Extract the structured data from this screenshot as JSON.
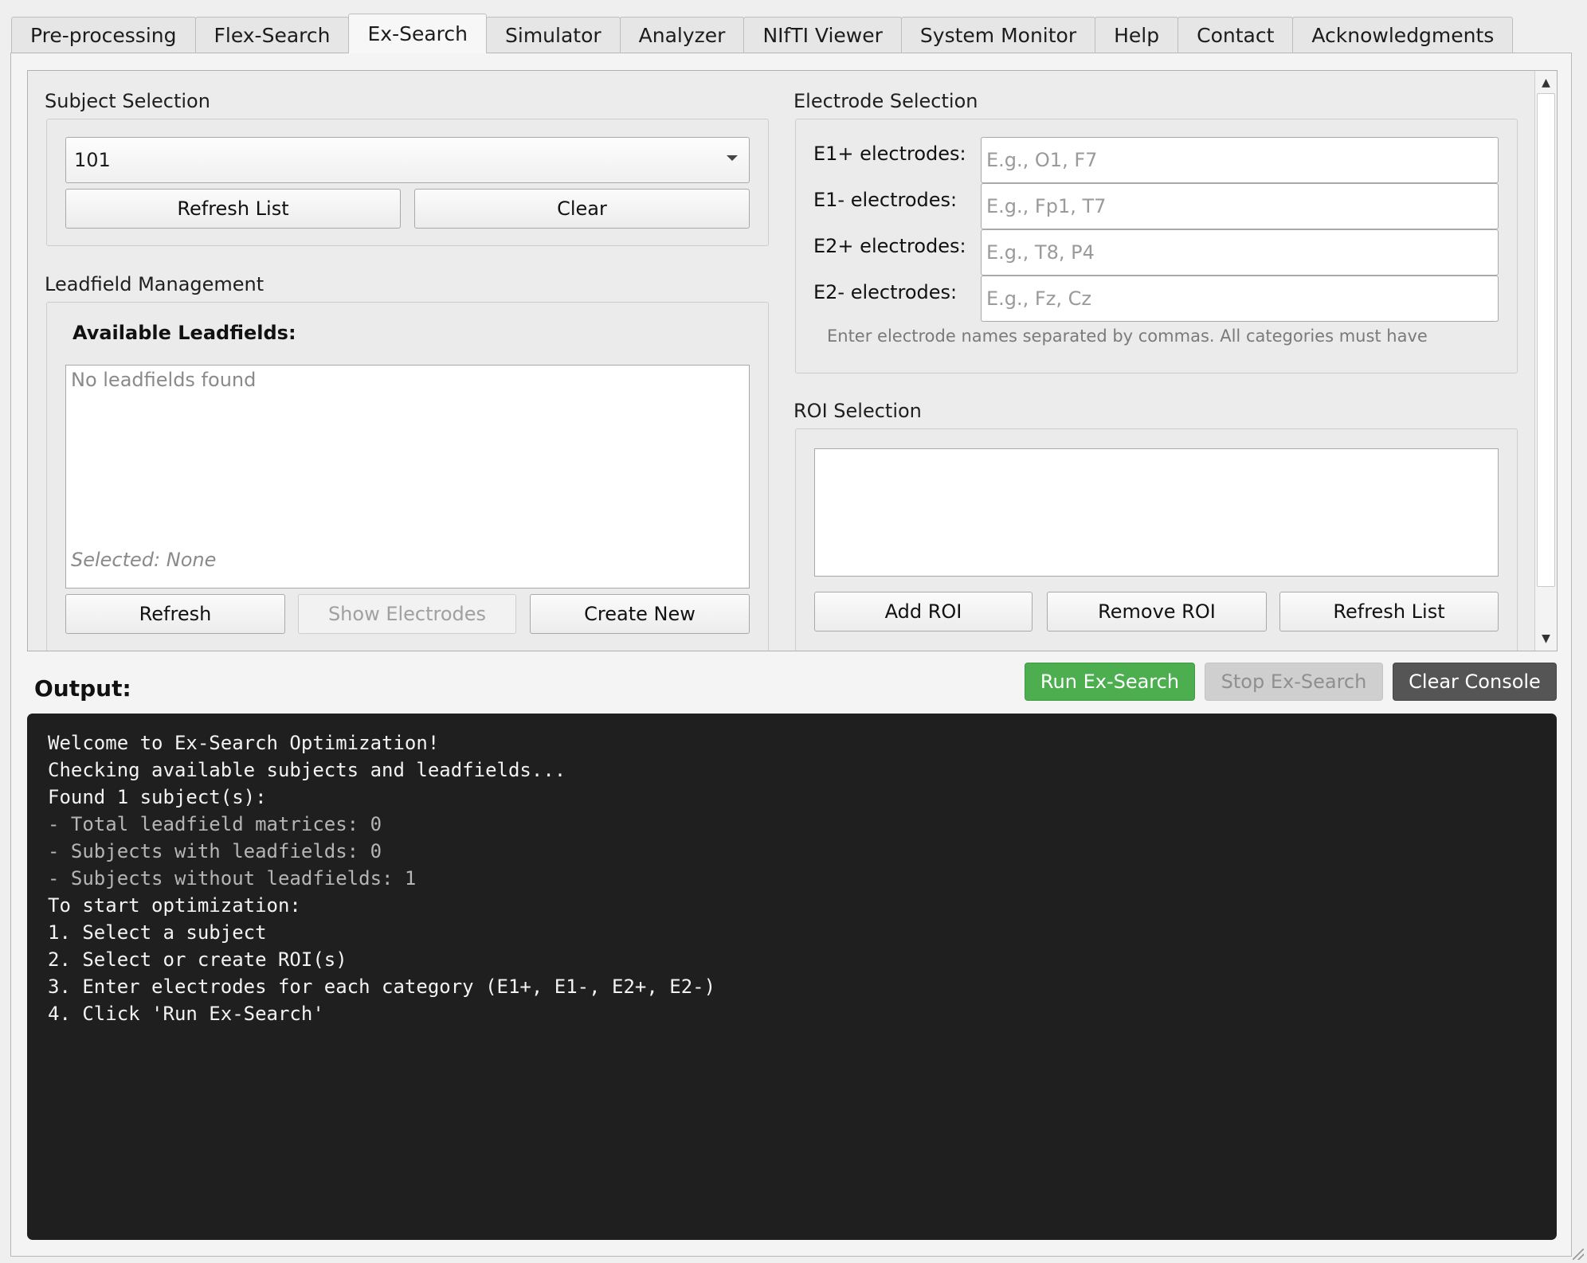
{
  "tabs": [
    {
      "label": "Pre-processing",
      "active": false
    },
    {
      "label": "Flex-Search",
      "active": false
    },
    {
      "label": "Ex-Search",
      "active": true
    },
    {
      "label": "Simulator",
      "active": false
    },
    {
      "label": "Analyzer",
      "active": false
    },
    {
      "label": "NIfTI Viewer",
      "active": false
    },
    {
      "label": "System Monitor",
      "active": false
    },
    {
      "label": "Help",
      "active": false
    },
    {
      "label": "Contact",
      "active": false
    },
    {
      "label": "Acknowledgments",
      "active": false
    }
  ],
  "subject_selection": {
    "title": "Subject Selection",
    "selected": "101",
    "refresh_label": "Refresh List",
    "clear_label": "Clear"
  },
  "leadfield": {
    "title": "Leadfield Management",
    "heading": "Available Leadfields:",
    "empty_text": "No leadfields found",
    "selected_text": "Selected: None",
    "refresh_label": "Refresh",
    "show_electrodes_label": "Show Electrodes",
    "create_new_label": "Create New"
  },
  "electrodes": {
    "title": "Electrode Selection",
    "e1_plus": {
      "label": "E1+ electrodes:",
      "placeholder": "E.g., O1, F7",
      "value": ""
    },
    "e1_minus": {
      "label": "E1- electrodes:",
      "placeholder": "E.g., Fp1, T7",
      "value": ""
    },
    "e2_plus": {
      "label": "E2+ electrodes:",
      "placeholder": "E.g., T8, P4",
      "value": ""
    },
    "e2_minus": {
      "label": "E2- electrodes:",
      "placeholder": "E.g., Fz, Cz",
      "value": ""
    },
    "hint": "Enter electrode names separated by commas. All categories must have"
  },
  "roi": {
    "title": "ROI Selection",
    "add_label": "Add ROI",
    "remove_label": "Remove ROI",
    "refresh_label": "Refresh List"
  },
  "output": {
    "label": "Output:",
    "run_label": "Run Ex-Search",
    "stop_label": "Stop Ex-Search",
    "clear_label": "Clear Console",
    "lines": [
      {
        "text": "Welcome to Ex-Search Optimization!",
        "dim": false
      },
      {
        "text": "Checking available subjects and leadfields...",
        "dim": false
      },
      {
        "text": "Found 1 subject(s):",
        "dim": false
      },
      {
        "text": "- Total leadfield matrices: 0",
        "dim": true
      },
      {
        "text": "- Subjects with leadfields: 0",
        "dim": true
      },
      {
        "text": "- Subjects without leadfields: 1",
        "dim": true
      },
      {
        "text": "To start optimization:",
        "dim": false
      },
      {
        "text": "1. Select a subject",
        "dim": false
      },
      {
        "text": "2. Select or create ROI(s)",
        "dim": false
      },
      {
        "text": "3. Enter electrodes for each category (E1+, E1-, E2+, E2-)",
        "dim": false
      },
      {
        "text": "4. Click 'Run Ex-Search'",
        "dim": false
      }
    ]
  },
  "colors": {
    "run_button": "#4cae4f",
    "clear_button": "#555555",
    "console_bg": "#1f1f1f"
  }
}
